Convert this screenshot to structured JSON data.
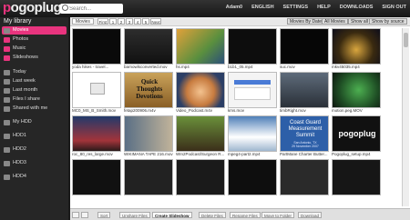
{
  "app": {
    "logo_prefix": "p",
    "logo_rest": "ogoplug"
  },
  "search": {
    "placeholder": "Search..."
  },
  "topnav": [
    "Adam0",
    "ENGLISH",
    "SETTINGS",
    "HELP",
    "DOWNLOADS",
    "SIGN OUT"
  ],
  "sidebar": {
    "title": "My library",
    "items": [
      "Movies",
      "Photos",
      "Music",
      "Slideshows",
      "Today",
      "Last week",
      "Last month",
      "Files I share",
      "Shared with me",
      "My HDD",
      "HDD1",
      "HDD2",
      "HDD3",
      "HDD4"
    ]
  },
  "toolbar": {
    "tab": "Movies",
    "pages": [
      "First",
      "1",
      "2",
      "3",
      "4",
      "5",
      "Next"
    ],
    "by_date": "Movies By Date",
    "all_movies": "All Movies",
    "show_all": "Show all",
    "by_source": "Show by source"
  },
  "items": [
    "yoda hikes - travel...",
    "barnowlsconverted.mov",
    "hs.mp4",
    "b1b1_05.mp4",
    "suc.mov",
    "mkv45035.mp4",
    "MC0_MS_B_Smith.mov",
    "fetap200906.m4v",
    "Video_Podcast.m4v",
    "kms.mov",
    "timbRight.mov",
    "motion.peg.MOV",
    "roc_80_res_large.mov",
    "WIKIMANA TAPE 216.mov",
    "WIn2Podcast/Surgeon R...",
    "mpeg4-part2.mp4",
    "PartMane Charter Butter...",
    "Pogoplug_setup.mp4"
  ],
  "thumb_text": {
    "uploading": "UPLOADING",
    "quick": "Quick Thoughts Devotions",
    "coast": "Coast Guard Measurement Summit",
    "coast_sub": "San Antonio, TX\n29 November 2007",
    "pogo": "pogoplug"
  },
  "bottom": {
    "sort": "Sort",
    "unshare": "Unshare Files",
    "create": "Create Slideshow",
    "delete": "Delete Files",
    "rename": "Rename Files",
    "move": "Move to Folder",
    "download": "Download"
  },
  "colors": {
    "accent": "#e8347e"
  }
}
